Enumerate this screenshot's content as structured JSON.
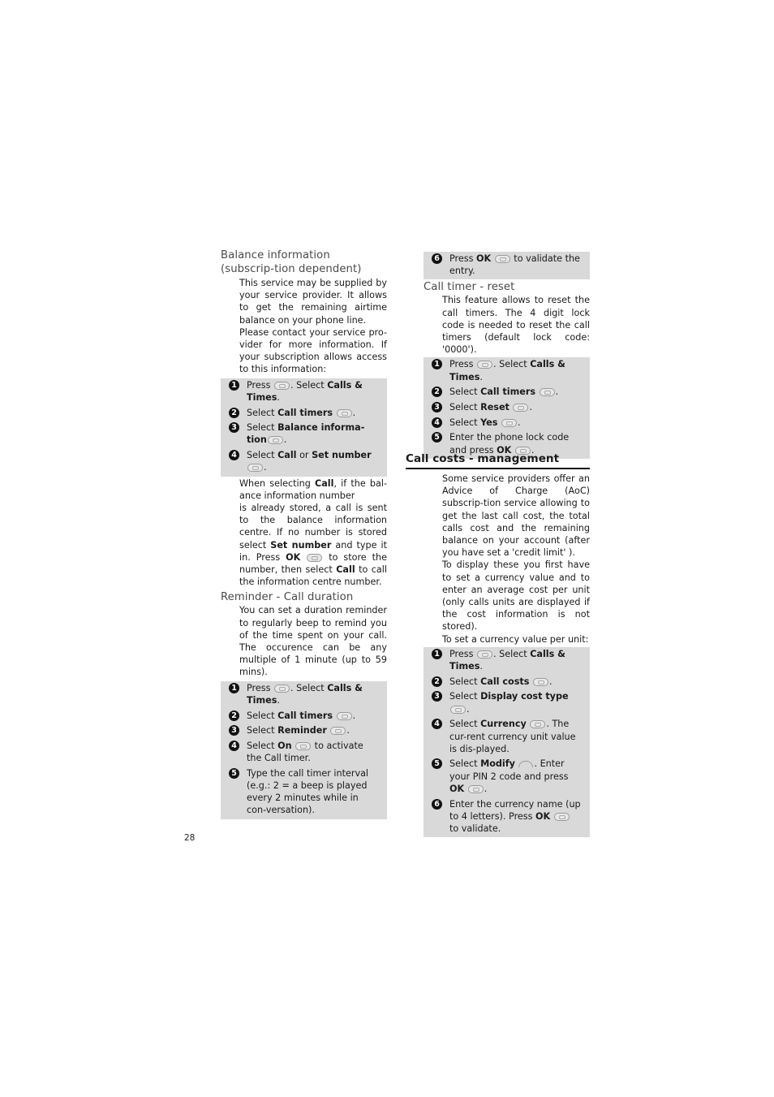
{
  "page_number": "28",
  "left_column": {
    "balance": {
      "heading": "Balance information (subscrip-tion dependent)",
      "intro": [
        "This service may be supplied by your service provider. It allows to get the remaining airtime balance on your phone line.",
        "Please contact your service pro-vider for more information. If your subscription allows access to this information:"
      ],
      "steps": [
        {
          "num": "1",
          "parts": [
            "Press ",
            {
              "icon": "ok-key-icon"
            },
            ". Select ",
            {
              "b": "Calls & Times"
            },
            "."
          ]
        },
        {
          "num": "2",
          "parts": [
            "Select ",
            {
              "b": "Call timers"
            },
            " ",
            {
              "icon": "ok-key-icon"
            },
            "."
          ]
        },
        {
          "num": "3",
          "parts": [
            "Select ",
            {
              "b": "Balance informa-tion"
            },
            {
              "icon": "ok-key-icon"
            },
            "."
          ]
        },
        {
          "num": "4",
          "parts": [
            "Select ",
            {
              "b": "Call"
            },
            " or ",
            {
              "b": "Set number"
            },
            " ",
            {
              "icon": "ok-key-icon"
            },
            "."
          ]
        }
      ],
      "note": [
        [
          "When selecting ",
          {
            "b": "Call"
          },
          ", if the bal-ance information number"
        ],
        [
          "is already stored, a call is sent to the balance information centre. If no number is stored select ",
          {
            "b": "Set number"
          },
          " and type it in. Press ",
          {
            "b": "OK"
          },
          " ",
          {
            "icon": "ok-key-icon"
          },
          " to store the number, then select ",
          {
            "b": "Call"
          },
          " to call the information centre number."
        ]
      ]
    },
    "reminder": {
      "heading": "Reminder - Call duration",
      "intro": [
        "You can set a duration reminder to regularly beep to remind you of the time spent on your call. The occurence can be any multiple of 1 minute (up to 59 mins)."
      ],
      "steps": [
        {
          "num": "1",
          "parts": [
            "Press ",
            {
              "icon": "ok-key-icon"
            },
            ". Select ",
            {
              "b": "Calls & Times"
            },
            "."
          ]
        },
        {
          "num": "2",
          "parts": [
            "Select ",
            {
              "b": "Call timers"
            },
            " ",
            {
              "icon": "ok-key-icon"
            },
            "."
          ]
        },
        {
          "num": "3",
          "parts": [
            "Select ",
            {
              "b": "Reminder"
            },
            " ",
            {
              "icon": "ok-key-icon"
            },
            "."
          ]
        },
        {
          "num": "4",
          "parts": [
            "Select ",
            {
              "b": "On"
            },
            " ",
            {
              "icon": "ok-key-icon"
            },
            " to activate the Call timer."
          ]
        },
        {
          "num": "5",
          "parts": [
            "Type the call timer interval (e.g.: 2 = a beep is played every 2 minutes while in con-versation)."
          ]
        }
      ]
    }
  },
  "right_column": {
    "reminder_continued": {
      "steps": [
        {
          "num": "6",
          "parts": [
            "Press ",
            {
              "b": "OK"
            },
            " ",
            {
              "icon": "ok-key-icon"
            },
            " to validate the entry."
          ]
        }
      ]
    },
    "reset": {
      "heading": "Call timer - reset",
      "intro": [
        "This feature allows to reset the call timers. The 4 digit lock code is needed to reset the call timers (default lock code: '0000')."
      ],
      "steps": [
        {
          "num": "1",
          "parts": [
            "Press ",
            {
              "icon": "ok-key-icon"
            },
            ". Select ",
            {
              "b": "Calls & Times"
            },
            "."
          ]
        },
        {
          "num": "2",
          "parts": [
            "Select ",
            {
              "b": "Call timers"
            },
            " ",
            {
              "icon": "ok-key-icon"
            },
            "."
          ]
        },
        {
          "num": "3",
          "parts": [
            "Select ",
            {
              "b": "Reset"
            },
            " ",
            {
              "icon": "ok-key-icon"
            },
            "."
          ]
        },
        {
          "num": "4",
          "parts": [
            "Select ",
            {
              "b": "Yes"
            },
            " ",
            {
              "icon": "ok-key-icon"
            },
            "."
          ]
        },
        {
          "num": "5",
          "parts": [
            "Enter the phone lock code and press ",
            {
              "b": "OK"
            },
            " ",
            {
              "icon": "ok-key-icon"
            },
            "."
          ]
        }
      ]
    },
    "costs": {
      "section_title": "Call costs - management",
      "intro": [
        "Some service providers offer an Advice of Charge (AoC) subscrip-tion service allowing to get the last call cost, the total calls cost and the remaining balance on your account (after you have set a 'credit limit' ).",
        "To display these  you first have to set a currency value and to enter an average cost per unit (only calls units are displayed if the cost information is not stored).",
        "To set a currency value per unit:"
      ],
      "steps": [
        {
          "num": "1",
          "parts": [
            "Press ",
            {
              "icon": "ok-key-icon"
            },
            ". Select ",
            {
              "b": "Calls & Times"
            },
            "."
          ]
        },
        {
          "num": "2",
          "parts": [
            "Select ",
            {
              "b": "Call costs"
            },
            " ",
            {
              "icon": "ok-key-icon"
            },
            "."
          ]
        },
        {
          "num": "3",
          "parts": [
            "Select ",
            {
              "b": "Display cost type"
            },
            " ",
            {
              "icon": "ok-key-icon"
            },
            "."
          ]
        },
        {
          "num": "4",
          "parts": [
            "Select ",
            {
              "b": "Currency"
            },
            " ",
            {
              "icon": "ok-key-icon"
            },
            ". The cur-rent currency unit value is dis-played."
          ]
        },
        {
          "num": "5",
          "parts": [
            "Select ",
            {
              "b": "Modify"
            },
            " ",
            {
              "icon": "softkey-icon"
            },
            ". Enter your PIN 2 code and press ",
            {
              "b": "OK"
            },
            " ",
            {
              "icon": "ok-key-icon"
            },
            "."
          ]
        },
        {
          "num": "6",
          "parts": [
            "Enter the currency name (up to 4 letters). Press ",
            {
              "b": "OK"
            },
            " ",
            {
              "icon": "ok-key-icon"
            },
            " to validate."
          ]
        }
      ]
    }
  }
}
